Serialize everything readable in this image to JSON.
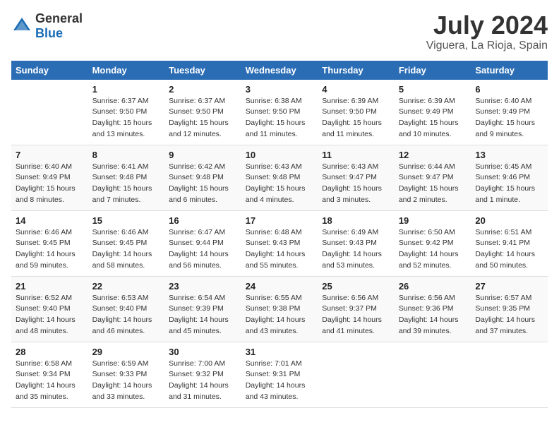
{
  "logo": {
    "general": "General",
    "blue": "Blue"
  },
  "header": {
    "title": "July 2024",
    "subtitle": "Viguera, La Rioja, Spain"
  },
  "weekdays": [
    "Sunday",
    "Monday",
    "Tuesday",
    "Wednesday",
    "Thursday",
    "Friday",
    "Saturday"
  ],
  "weeks": [
    [
      {
        "day": "",
        "sunrise": "",
        "sunset": "",
        "daylight": ""
      },
      {
        "day": "1",
        "sunrise": "Sunrise: 6:37 AM",
        "sunset": "Sunset: 9:50 PM",
        "daylight": "Daylight: 15 hours and 13 minutes."
      },
      {
        "day": "2",
        "sunrise": "Sunrise: 6:37 AM",
        "sunset": "Sunset: 9:50 PM",
        "daylight": "Daylight: 15 hours and 12 minutes."
      },
      {
        "day": "3",
        "sunrise": "Sunrise: 6:38 AM",
        "sunset": "Sunset: 9:50 PM",
        "daylight": "Daylight: 15 hours and 11 minutes."
      },
      {
        "day": "4",
        "sunrise": "Sunrise: 6:39 AM",
        "sunset": "Sunset: 9:50 PM",
        "daylight": "Daylight: 15 hours and 11 minutes."
      },
      {
        "day": "5",
        "sunrise": "Sunrise: 6:39 AM",
        "sunset": "Sunset: 9:49 PM",
        "daylight": "Daylight: 15 hours and 10 minutes."
      },
      {
        "day": "6",
        "sunrise": "Sunrise: 6:40 AM",
        "sunset": "Sunset: 9:49 PM",
        "daylight": "Daylight: 15 hours and 9 minutes."
      }
    ],
    [
      {
        "day": "7",
        "sunrise": "Sunrise: 6:40 AM",
        "sunset": "Sunset: 9:49 PM",
        "daylight": "Daylight: 15 hours and 8 minutes."
      },
      {
        "day": "8",
        "sunrise": "Sunrise: 6:41 AM",
        "sunset": "Sunset: 9:48 PM",
        "daylight": "Daylight: 15 hours and 7 minutes."
      },
      {
        "day": "9",
        "sunrise": "Sunrise: 6:42 AM",
        "sunset": "Sunset: 9:48 PM",
        "daylight": "Daylight: 15 hours and 6 minutes."
      },
      {
        "day": "10",
        "sunrise": "Sunrise: 6:43 AM",
        "sunset": "Sunset: 9:48 PM",
        "daylight": "Daylight: 15 hours and 4 minutes."
      },
      {
        "day": "11",
        "sunrise": "Sunrise: 6:43 AM",
        "sunset": "Sunset: 9:47 PM",
        "daylight": "Daylight: 15 hours and 3 minutes."
      },
      {
        "day": "12",
        "sunrise": "Sunrise: 6:44 AM",
        "sunset": "Sunset: 9:47 PM",
        "daylight": "Daylight: 15 hours and 2 minutes."
      },
      {
        "day": "13",
        "sunrise": "Sunrise: 6:45 AM",
        "sunset": "Sunset: 9:46 PM",
        "daylight": "Daylight: 15 hours and 1 minute."
      }
    ],
    [
      {
        "day": "14",
        "sunrise": "Sunrise: 6:46 AM",
        "sunset": "Sunset: 9:45 PM",
        "daylight": "Daylight: 14 hours and 59 minutes."
      },
      {
        "day": "15",
        "sunrise": "Sunrise: 6:46 AM",
        "sunset": "Sunset: 9:45 PM",
        "daylight": "Daylight: 14 hours and 58 minutes."
      },
      {
        "day": "16",
        "sunrise": "Sunrise: 6:47 AM",
        "sunset": "Sunset: 9:44 PM",
        "daylight": "Daylight: 14 hours and 56 minutes."
      },
      {
        "day": "17",
        "sunrise": "Sunrise: 6:48 AM",
        "sunset": "Sunset: 9:43 PM",
        "daylight": "Daylight: 14 hours and 55 minutes."
      },
      {
        "day": "18",
        "sunrise": "Sunrise: 6:49 AM",
        "sunset": "Sunset: 9:43 PM",
        "daylight": "Daylight: 14 hours and 53 minutes."
      },
      {
        "day": "19",
        "sunrise": "Sunrise: 6:50 AM",
        "sunset": "Sunset: 9:42 PM",
        "daylight": "Daylight: 14 hours and 52 minutes."
      },
      {
        "day": "20",
        "sunrise": "Sunrise: 6:51 AM",
        "sunset": "Sunset: 9:41 PM",
        "daylight": "Daylight: 14 hours and 50 minutes."
      }
    ],
    [
      {
        "day": "21",
        "sunrise": "Sunrise: 6:52 AM",
        "sunset": "Sunset: 9:40 PM",
        "daylight": "Daylight: 14 hours and 48 minutes."
      },
      {
        "day": "22",
        "sunrise": "Sunrise: 6:53 AM",
        "sunset": "Sunset: 9:40 PM",
        "daylight": "Daylight: 14 hours and 46 minutes."
      },
      {
        "day": "23",
        "sunrise": "Sunrise: 6:54 AM",
        "sunset": "Sunset: 9:39 PM",
        "daylight": "Daylight: 14 hours and 45 minutes."
      },
      {
        "day": "24",
        "sunrise": "Sunrise: 6:55 AM",
        "sunset": "Sunset: 9:38 PM",
        "daylight": "Daylight: 14 hours and 43 minutes."
      },
      {
        "day": "25",
        "sunrise": "Sunrise: 6:56 AM",
        "sunset": "Sunset: 9:37 PM",
        "daylight": "Daylight: 14 hours and 41 minutes."
      },
      {
        "day": "26",
        "sunrise": "Sunrise: 6:56 AM",
        "sunset": "Sunset: 9:36 PM",
        "daylight": "Daylight: 14 hours and 39 minutes."
      },
      {
        "day": "27",
        "sunrise": "Sunrise: 6:57 AM",
        "sunset": "Sunset: 9:35 PM",
        "daylight": "Daylight: 14 hours and 37 minutes."
      }
    ],
    [
      {
        "day": "28",
        "sunrise": "Sunrise: 6:58 AM",
        "sunset": "Sunset: 9:34 PM",
        "daylight": "Daylight: 14 hours and 35 minutes."
      },
      {
        "day": "29",
        "sunrise": "Sunrise: 6:59 AM",
        "sunset": "Sunset: 9:33 PM",
        "daylight": "Daylight: 14 hours and 33 minutes."
      },
      {
        "day": "30",
        "sunrise": "Sunrise: 7:00 AM",
        "sunset": "Sunset: 9:32 PM",
        "daylight": "Daylight: 14 hours and 31 minutes."
      },
      {
        "day": "31",
        "sunrise": "Sunrise: 7:01 AM",
        "sunset": "Sunset: 9:31 PM",
        "daylight": "Daylight: 14 hours and 43 minutes."
      },
      {
        "day": "",
        "sunrise": "",
        "sunset": "",
        "daylight": ""
      },
      {
        "day": "",
        "sunrise": "",
        "sunset": "",
        "daylight": ""
      },
      {
        "day": "",
        "sunrise": "",
        "sunset": "",
        "daylight": ""
      }
    ]
  ]
}
